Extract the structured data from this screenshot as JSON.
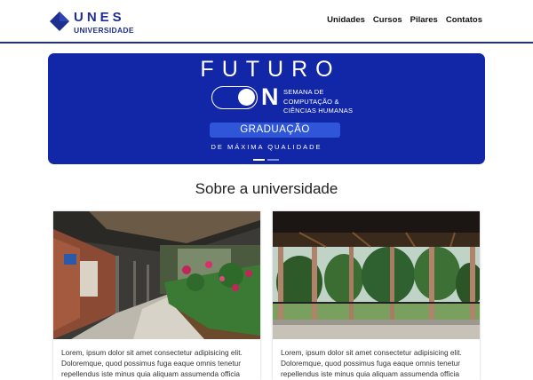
{
  "brand": {
    "name_top": "UNES",
    "name_bottom": "UNIVERSIDADE",
    "color": "#1e2f8f",
    "icon": "diamond-logo-icon"
  },
  "nav": {
    "items": [
      {
        "label": "Unidades"
      },
      {
        "label": "Cursos"
      },
      {
        "label": "Pilares"
      },
      {
        "label": "Contatos"
      }
    ]
  },
  "hero": {
    "title": "FUTURO",
    "on_text": "N",
    "subtitle_lines": [
      "SEMANA DE",
      "COMPUTAÇÃO &",
      "CIÊNCIAS HUMANAS"
    ],
    "badge": "GRADUAÇÃO",
    "tagline": "DE MÁXIMA QUALIDADE",
    "background_color": "#1226a8",
    "badge_color": "#2f56d8",
    "slides_total": 2,
    "active_slide": 1
  },
  "about": {
    "title": "Sobre a universidade",
    "cards": [
      {
        "photo": "campus-corridor-with-garden-photo",
        "text": "Lorem, ipsum dolor sit amet consectetur adipisicing elit. Doloremque, quod possimus fuga eaque omnis tenetur repellendus iste minus quia aliquam assumenda officia"
      },
      {
        "photo": "open-hall-with-trees-photo",
        "text": "Lorem, ipsum dolor sit amet consectetur adipisicing elit. Doloremque, quod possimus fuga eaque omnis tenetur repellendus iste minus quia aliquam assumenda officia"
      }
    ]
  }
}
